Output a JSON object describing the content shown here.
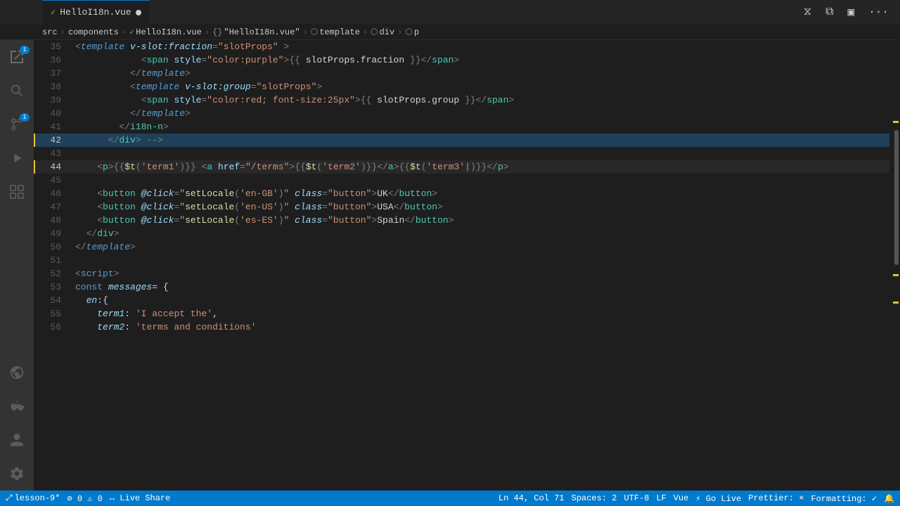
{
  "tab": {
    "icon": "✓",
    "filename": "HelloI18n.vue",
    "dirty": true
  },
  "breadcrumb": {
    "items": [
      "src",
      "components",
      "HelloI18n.vue",
      "\"HelloI18n.vue\"",
      "template",
      "div",
      "p"
    ]
  },
  "activityBar": {
    "buttons": [
      {
        "name": "explorer",
        "icon": "⧉",
        "active": false,
        "badge": "1"
      },
      {
        "name": "search",
        "icon": "🔍",
        "active": false
      },
      {
        "name": "source-control",
        "icon": "⎇",
        "active": false,
        "badge": "1"
      },
      {
        "name": "run-debug",
        "icon": "▷",
        "active": false
      },
      {
        "name": "extensions",
        "icon": "⊞",
        "active": false
      },
      {
        "name": "remote-explorer",
        "icon": "◫",
        "active": false
      },
      {
        "name": "docker",
        "icon": "🐋",
        "active": false
      }
    ],
    "bottomButtons": [
      {
        "name": "accounts",
        "icon": "◯",
        "active": false
      },
      {
        "name": "settings",
        "icon": "⚙",
        "active": false
      }
    ]
  },
  "statusBar": {
    "left": [
      {
        "name": "remote",
        "text": "lesson-9*"
      },
      {
        "name": "errors",
        "text": "⊘ 0  ⚠ 0"
      },
      {
        "name": "live-share",
        "text": "↔ Live Share"
      }
    ],
    "right": [
      {
        "name": "cursor-pos",
        "text": "Ln 44, Col 71"
      },
      {
        "name": "spaces",
        "text": "Spaces: 2"
      },
      {
        "name": "encoding",
        "text": "UTF-8"
      },
      {
        "name": "line-ending",
        "text": "LF"
      },
      {
        "name": "language",
        "text": "Vue"
      },
      {
        "name": "go-live",
        "text": "⚡ Go Live"
      },
      {
        "name": "prettier",
        "text": "Prettier: ×"
      },
      {
        "name": "formatting",
        "text": "Formatting: ✓"
      },
      {
        "name": "notifications",
        "text": "🔔"
      }
    ]
  },
  "code": {
    "lines": [
      {
        "num": 35,
        "indent": "          ",
        "content": "<template v-slot:fraction=\"slotProps\" >"
      },
      {
        "num": 36,
        "indent": "            ",
        "content": "<span style=\"color:purple\">{{ slotProps.fraction }}</span>"
      },
      {
        "num": 37,
        "indent": "          ",
        "content": "</template>"
      },
      {
        "num": 38,
        "indent": "          ",
        "content": "<template v-slot:group=\"slotProps\">"
      },
      {
        "num": 39,
        "indent": "            ",
        "content": "<span style=\"color:red; font-size:25px\">{{ slotProps.group }}</span>"
      },
      {
        "num": 40,
        "indent": "          ",
        "content": "</template>"
      },
      {
        "num": 41,
        "indent": "        ",
        "content": "</i18n-n>"
      },
      {
        "num": 42,
        "indent": "      ",
        "content": "</div> -->"
      },
      {
        "num": 43,
        "indent": "",
        "content": ""
      },
      {
        "num": 44,
        "indent": "    ",
        "content": "<p>{{$t('term1')}} <a href=\"/terms\">{{$t('term2')}}</a>{{$t('term3')}}</p>",
        "active": true
      },
      {
        "num": 45,
        "indent": "",
        "content": ""
      },
      {
        "num": 46,
        "indent": "    ",
        "content": "<button @click=\"setLocale('en-GB')\" class=\"button\">UK</button>"
      },
      {
        "num": 47,
        "indent": "    ",
        "content": "<button @click=\"setLocale('en-US')\" class=\"button\">USA</button>"
      },
      {
        "num": 48,
        "indent": "    ",
        "content": "<button @click=\"setLocale('es-ES')\" class=\"button\">Spain</button>"
      },
      {
        "num": 49,
        "indent": "  ",
        "content": "</div>"
      },
      {
        "num": 50,
        "indent": "",
        "content": "</template>"
      },
      {
        "num": 51,
        "indent": "",
        "content": ""
      },
      {
        "num": 52,
        "indent": "",
        "content": "<script>"
      },
      {
        "num": 53,
        "indent": "",
        "content": "const messages= {"
      },
      {
        "num": 54,
        "indent": "  ",
        "content": "en:{"
      },
      {
        "num": 55,
        "indent": "    ",
        "content": "term1: 'I accept the',"
      },
      {
        "num": 56,
        "indent": "    ",
        "content": "term2: 'terms and conditions'"
      }
    ]
  }
}
